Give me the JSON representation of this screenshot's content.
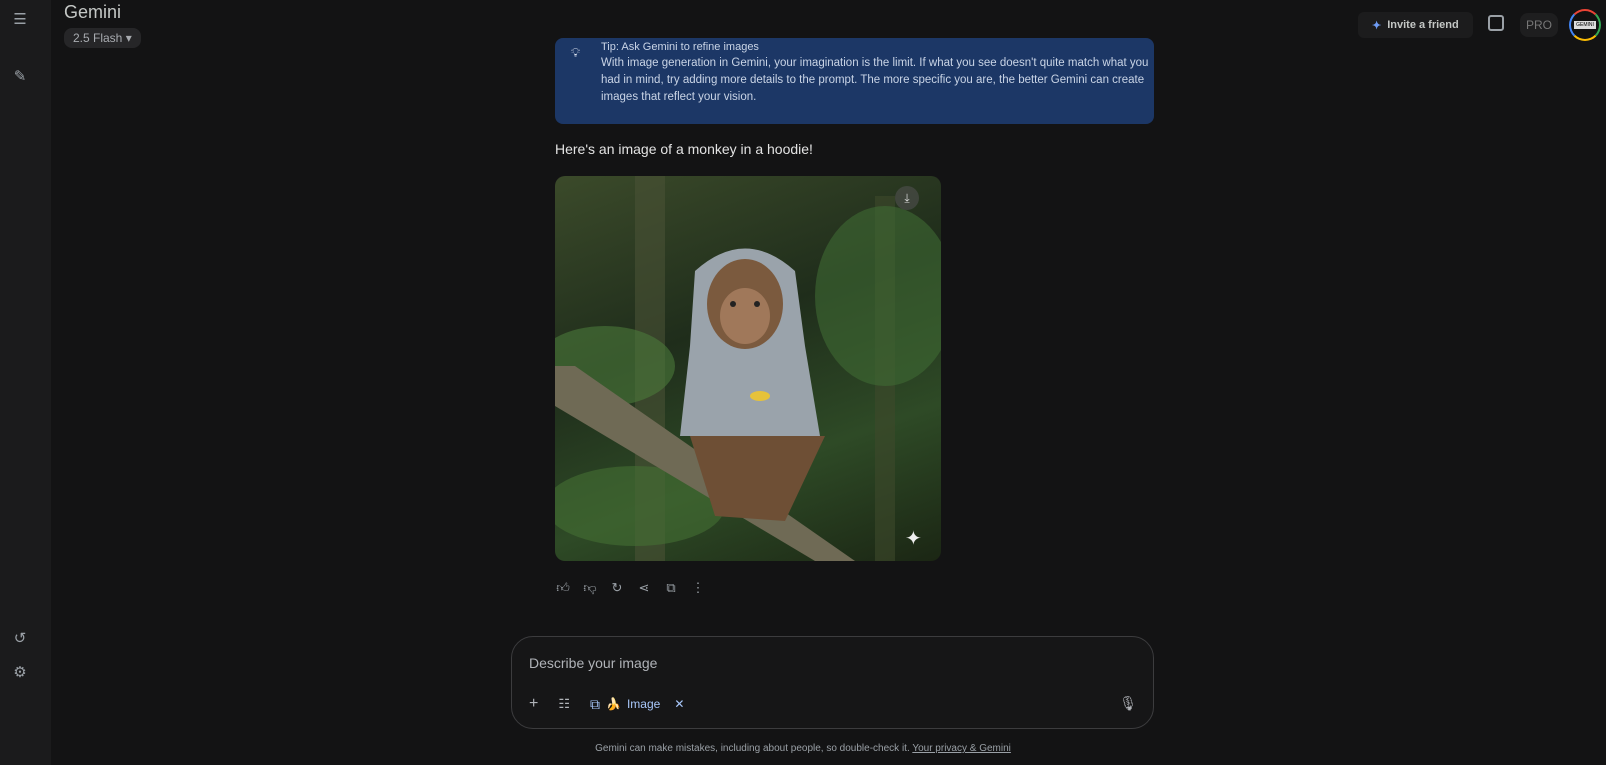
{
  "app": {
    "title": "Gemini",
    "model": "2.5 Flash"
  },
  "header": {
    "invite": "Invite a friend",
    "pro": "PRO",
    "avatar_text": "GEMINI"
  },
  "tip": {
    "title": "Tip: Ask Gemini to refine images",
    "body": "With image generation in Gemini, your imagination is the limit. If what you see doesn't quite match what you had in mind, try adding more details to the prompt. The more specific you are, the better Gemini can create images that reflect your vision."
  },
  "response": {
    "text": "Here's an image of a monkey in a hoodie!"
  },
  "composer": {
    "placeholder": "Describe your image",
    "chip": "Image",
    "chip_emoji": "🍌"
  },
  "footer": {
    "disclaimer": "Gemini can make mistakes, including about people, so double-check it. ",
    "link": "Your privacy & Gemini"
  },
  "colors": {
    "tip_bg": "#1c3766",
    "chip": "#a8c7fa"
  }
}
